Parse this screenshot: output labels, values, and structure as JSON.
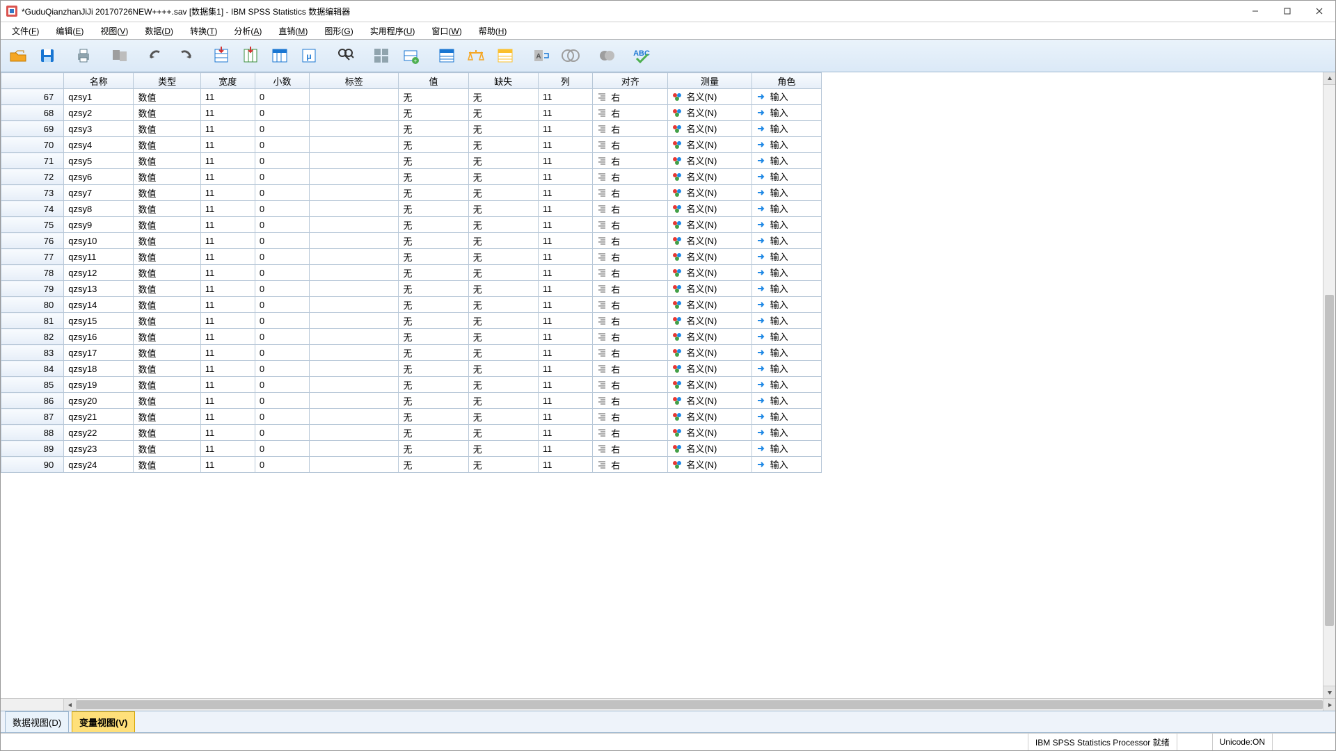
{
  "window": {
    "title": "*GuduQianzhanJiJi 20170726NEW++++.sav [数据集1] - IBM SPSS Statistics 数据编辑器"
  },
  "menu": {
    "items": [
      {
        "label": "文件",
        "key": "F"
      },
      {
        "label": "编辑",
        "key": "E"
      },
      {
        "label": "视图",
        "key": "V"
      },
      {
        "label": "数据",
        "key": "D"
      },
      {
        "label": "转换",
        "key": "T"
      },
      {
        "label": "分析",
        "key": "A"
      },
      {
        "label": "直销",
        "key": "M"
      },
      {
        "label": "图形",
        "key": "G"
      },
      {
        "label": "实用程序",
        "key": "U"
      },
      {
        "label": "窗口",
        "key": "W"
      },
      {
        "label": "帮助",
        "key": "H"
      }
    ]
  },
  "columns": {
    "rownum": "",
    "name": "名称",
    "type": "类型",
    "width": "宽度",
    "decimals": "小数",
    "label": "标签",
    "values": "值",
    "missing": "缺失",
    "cols": "列",
    "align": "对齐",
    "measure": "测量",
    "role": "角色"
  },
  "cell_values": {
    "type": "数值",
    "width": "11",
    "decimals": "0",
    "label": "",
    "values": "无",
    "missing": "无",
    "cols": "11",
    "align": "右",
    "measure": "名义(N)",
    "role": "输入"
  },
  "rows": [
    {
      "num": "67",
      "name": "qzsy1"
    },
    {
      "num": "68",
      "name": "qzsy2"
    },
    {
      "num": "69",
      "name": "qzsy3"
    },
    {
      "num": "70",
      "name": "qzsy4"
    },
    {
      "num": "71",
      "name": "qzsy5"
    },
    {
      "num": "72",
      "name": "qzsy6"
    },
    {
      "num": "73",
      "name": "qzsy7"
    },
    {
      "num": "74",
      "name": "qzsy8"
    },
    {
      "num": "75",
      "name": "qzsy9"
    },
    {
      "num": "76",
      "name": "qzsy10"
    },
    {
      "num": "77",
      "name": "qzsy11"
    },
    {
      "num": "78",
      "name": "qzsy12"
    },
    {
      "num": "79",
      "name": "qzsy13"
    },
    {
      "num": "80",
      "name": "qzsy14"
    },
    {
      "num": "81",
      "name": "qzsy15"
    },
    {
      "num": "82",
      "name": "qzsy16"
    },
    {
      "num": "83",
      "name": "qzsy17"
    },
    {
      "num": "84",
      "name": "qzsy18"
    },
    {
      "num": "85",
      "name": "qzsy19"
    },
    {
      "num": "86",
      "name": "qzsy20"
    },
    {
      "num": "87",
      "name": "qzsy21"
    },
    {
      "num": "88",
      "name": "qzsy22"
    },
    {
      "num": "89",
      "name": "qzsy23"
    },
    {
      "num": "90",
      "name": "qzsy24"
    }
  ],
  "tabs": {
    "data_view": "数据视图(D)",
    "variable_view": "变量视图(V)"
  },
  "status": {
    "processor": "IBM SPSS Statistics Processor 就绪",
    "unicode": "Unicode:ON"
  }
}
